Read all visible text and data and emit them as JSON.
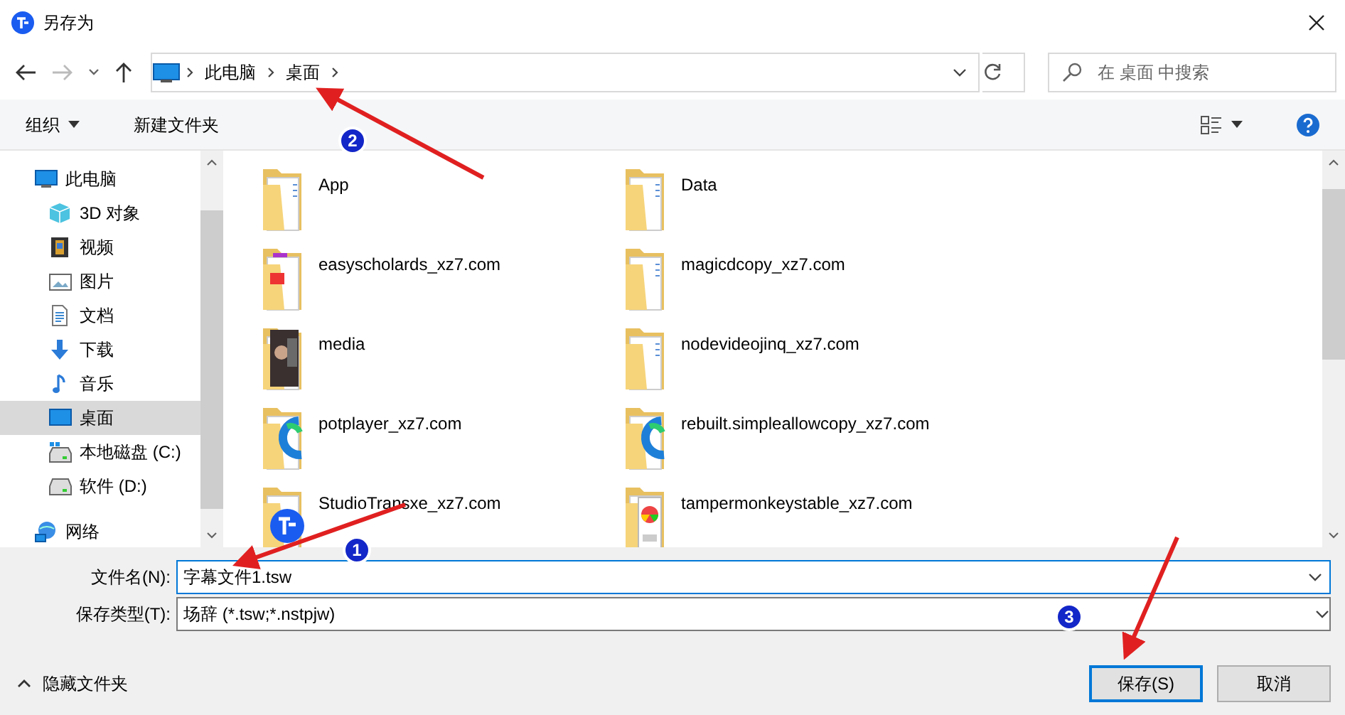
{
  "window": {
    "title": "另存为"
  },
  "address": {
    "segments": [
      "此电脑",
      "桌面"
    ]
  },
  "search": {
    "placeholder": "在 桌面 中搜索"
  },
  "toolbar": {
    "organize": "组织",
    "new_folder": "新建文件夹"
  },
  "sidebar": {
    "items": [
      {
        "label": "此电脑",
        "kind": "pc",
        "selected": false,
        "children": [
          {
            "label": "3D 对象",
            "kind": "cube",
            "selected": false
          },
          {
            "label": "视频",
            "kind": "video",
            "selected": false
          },
          {
            "label": "图片",
            "kind": "image",
            "selected": false
          },
          {
            "label": "文档",
            "kind": "doc",
            "selected": false
          },
          {
            "label": "下载",
            "kind": "download",
            "selected": false
          },
          {
            "label": "音乐",
            "kind": "music",
            "selected": false
          },
          {
            "label": "桌面",
            "kind": "desktop",
            "selected": true
          },
          {
            "label": "本地磁盘 (C:)",
            "kind": "drive-c",
            "selected": false
          },
          {
            "label": "软件 (D:)",
            "kind": "drive-d",
            "selected": false
          }
        ]
      },
      {
        "label": "网络",
        "kind": "network",
        "selected": false
      }
    ]
  },
  "files": [
    {
      "name": "App",
      "kind": "folder"
    },
    {
      "name": "Data",
      "kind": "folder"
    },
    {
      "name": "easyscholards_xz7.com",
      "kind": "pdf"
    },
    {
      "name": "magicdcopy_xz7.com",
      "kind": "folder"
    },
    {
      "name": "media",
      "kind": "media"
    },
    {
      "name": "nodevideojinq_xz7.com",
      "kind": "folder"
    },
    {
      "name": "potplayer_xz7.com",
      "kind": "swirl"
    },
    {
      "name": "rebuilt.simpleallowcopy_xz7.com",
      "kind": "swirl"
    },
    {
      "name": "StudioTransxe_xz7.com",
      "kind": "tr"
    },
    {
      "name": "tampermonkeystable_xz7.com",
      "kind": "crx"
    }
  ],
  "file_name": {
    "label": "文件名(N):",
    "value": "字幕文件1.tsw"
  },
  "file_type": {
    "label": "保存类型(T):",
    "value": "场辞 (*.tsw;*.nstpjw)"
  },
  "hide_folders": "隐藏文件夹",
  "buttons": [
    {
      "label": "保存(S)",
      "default": true
    },
    {
      "label": "取消",
      "default": false
    }
  ],
  "annotations": [
    {
      "number": "2"
    },
    {
      "number": "1"
    },
    {
      "number": "3"
    }
  ]
}
